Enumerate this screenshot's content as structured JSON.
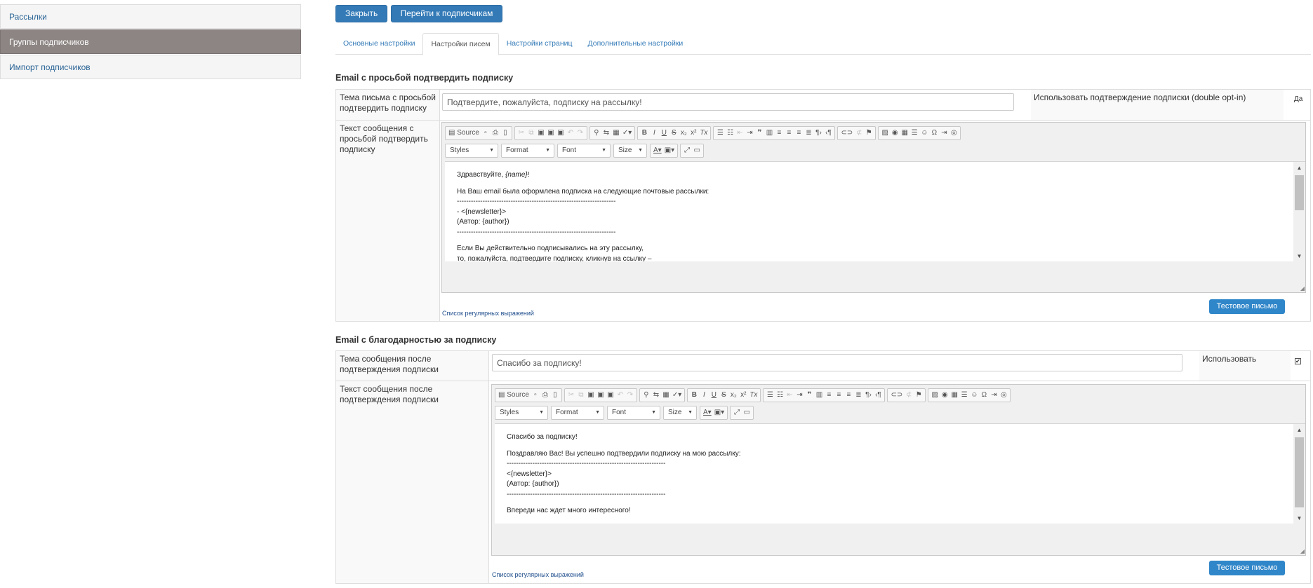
{
  "sidebar": {
    "items": [
      {
        "label": "Рассылки"
      },
      {
        "label": "Группы подписчиков"
      },
      {
        "label": "Импорт подписчиков"
      }
    ]
  },
  "actions": {
    "close_label": "Закрыть",
    "goto_subscribers_label": "Перейти к подписчикам"
  },
  "tabs": [
    {
      "label": "Основные настройки"
    },
    {
      "label": "Настройки писем"
    },
    {
      "label": "Настройки страниц"
    },
    {
      "label": "Дополнительные настройки"
    }
  ],
  "confirm_email": {
    "title": "Email с просьбой подтвердить подписку",
    "subject_label": "Тема письма с просьбой подтвердить подписку",
    "subject_value": "Подтвердите, пожалуйста, подписку на рассылку!",
    "double_optin_label": "Использовать подтверждение подписки (double opt-in)",
    "double_optin_value": "Да",
    "body_label": "Текст сообщения с просьбой подтвердить подписку",
    "body_greeting_prefix": "Здравствуйте, ",
    "body_greeting_var": "{name}",
    "body_greeting_suffix": "!",
    "body_line1": "На Ваш email была оформлена подписка на следующие почтовые рассылки:",
    "body_sep1": "--------------------------------------------------------------------",
    "body_line2": "- <{newsletter}>",
    "body_line3": "(Автор: {author})",
    "body_sep2": "--------------------------------------------------------------------",
    "body_line4": "Если Вы действительно подписывались на эту рассылку,",
    "body_line5": "то, пожалуйста, подтвердите подписку, кликнув на ссылку –",
    "regex_link": "Список регулярных выражений",
    "test_button": "Тестовое письмо"
  },
  "thanks_email": {
    "title": "Email с благодарностью за подписку",
    "subject_label": "Тема сообщения после подтверждения подписки",
    "subject_value": "Спасибо за подписку!",
    "use_label": "Использовать",
    "use_checked": "✔",
    "body_label": "Текст сообщения после подтверждения подписки",
    "body_line0": "Спасибо за подписку!",
    "body_line1": "Поздравляю Вас! Вы успешно подтвердили подписку на мою рассылку:",
    "body_sep1": "--------------------------------------------------------------------",
    "body_line2": "<{newsletter}>",
    "body_line3": "(Автор: {author})",
    "body_sep2": "--------------------------------------------------------------------",
    "body_line4": "Впереди нас ждет много интересного!",
    "regex_link": "Список регулярных выражений",
    "test_button": "Тестовое письмо"
  },
  "editor_toolbar": {
    "source": "Source",
    "styles": "Styles",
    "format": "Format",
    "font": "Font",
    "size": "Size"
  }
}
